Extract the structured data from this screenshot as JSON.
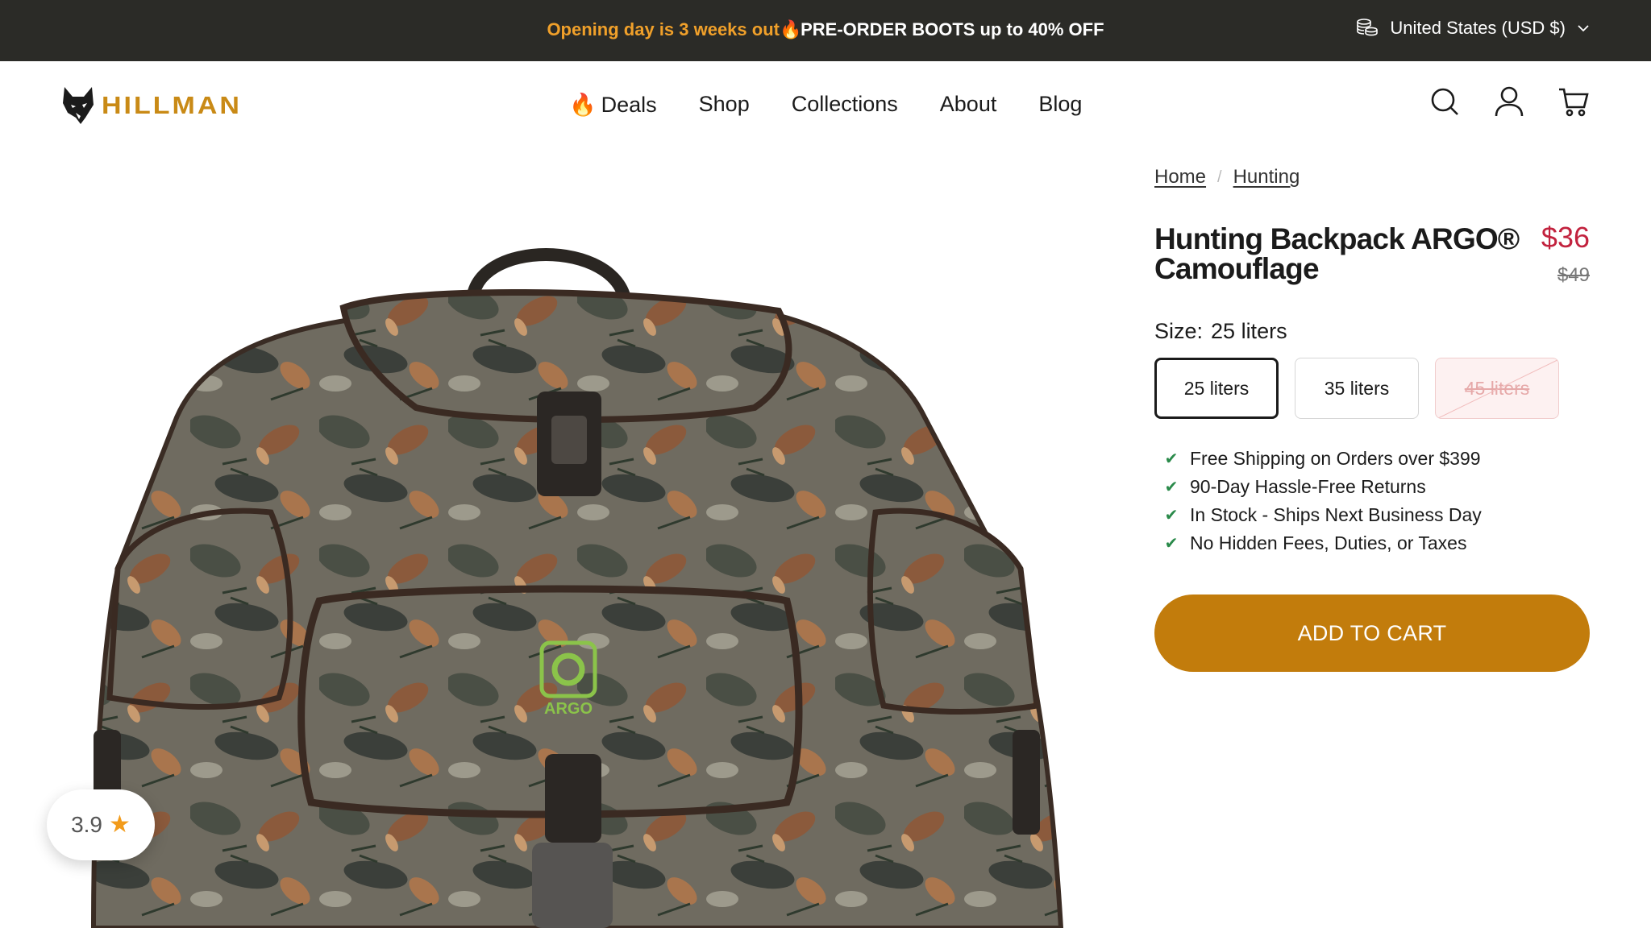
{
  "announcement": {
    "highlight": "Opening day is 3 weeks out",
    "emoji": "🔥",
    "message": " PRE-ORDER BOOTS up to 40% OFF",
    "currency": "United States (USD $)",
    "currency_icon": "coins-icon",
    "dropdown_icon": "chevron-down-icon"
  },
  "header": {
    "logo_text": "HILLMAN",
    "logo_icon": "wolf-head-icon",
    "nav": [
      {
        "label": "Deals",
        "emoji": "🔥"
      },
      {
        "label": "Shop"
      },
      {
        "label": "Collections"
      },
      {
        "label": "About"
      },
      {
        "label": "Blog"
      }
    ],
    "icons": [
      "search-icon",
      "account-icon",
      "cart-icon"
    ]
  },
  "breadcrumb": {
    "home": "Home",
    "separator": "/",
    "category": "Hunting"
  },
  "product": {
    "title": "Hunting Backpack ARGO® Camouflage",
    "price": "$36",
    "compare_price": "$49",
    "size_label": "Size:",
    "selected_size": "25 liters",
    "sizes": [
      {
        "label": "25 liters",
        "state": "selected"
      },
      {
        "label": "35 liters",
        "state": "available"
      },
      {
        "label": "45 liters",
        "state": "sold-out"
      }
    ],
    "features": [
      "Free Shipping on Orders over $399",
      "90-Day Hassle-Free Returns",
      "In Stock - Ships Next Business Day",
      "No Hidden Fees, Duties, or Taxes"
    ],
    "add_to_cart": "ADD TO CART",
    "image_brand": "ARGO"
  },
  "rating": {
    "value": "3.9",
    "star": "★"
  },
  "colors": {
    "announcement_bg": "#2b2b27",
    "accent": "#c27c0c",
    "highlight": "#f0a02a",
    "price": "#c2223e",
    "check": "#2a8a4a"
  }
}
